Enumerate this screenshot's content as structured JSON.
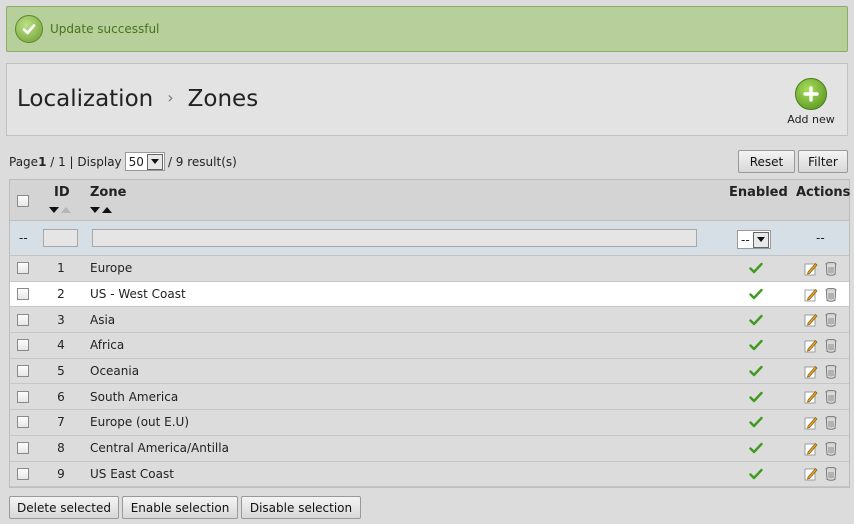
{
  "banner": {
    "message": "Update successful",
    "icon": "check-circle-icon"
  },
  "breadcrumb": {
    "parent": "Localization",
    "separator": "›",
    "current": "Zones"
  },
  "add_new": {
    "label": "Add new",
    "icon": "plus-circle-icon"
  },
  "pagination": {
    "page_prefix": "Page",
    "page_current": "1",
    "page_of": "/ 1 | Display",
    "display_value": "50",
    "results": "/ 9 result(s)"
  },
  "toolbar": {
    "reset_label": "Reset",
    "filter_label": "Filter"
  },
  "table": {
    "columns": {
      "id": "ID",
      "zone": "Zone",
      "enabled": "Enabled",
      "actions": "Actions"
    },
    "filter": {
      "checkbox_placeholder": "--",
      "enabled_value": "--",
      "actions_placeholder": "--"
    },
    "rows": [
      {
        "id": "1",
        "zone": "Europe",
        "enabled": true
      },
      {
        "id": "2",
        "zone": "US - West Coast",
        "enabled": true
      },
      {
        "id": "3",
        "zone": "Asia",
        "enabled": true
      },
      {
        "id": "4",
        "zone": "Africa",
        "enabled": true
      },
      {
        "id": "5",
        "zone": "Oceania",
        "enabled": true
      },
      {
        "id": "6",
        "zone": "South America",
        "enabled": true
      },
      {
        "id": "7",
        "zone": "Europe (out E.U)",
        "enabled": true
      },
      {
        "id": "8",
        "zone": "Central America/Antilla",
        "enabled": true
      },
      {
        "id": "9",
        "zone": "US East Coast",
        "enabled": true
      }
    ]
  },
  "bulk_actions": {
    "delete_label": "Delete selected",
    "enable_label": "Enable selection",
    "disable_label": "Disable selection"
  },
  "colors": {
    "accent_green": "#4f8e16",
    "banner_bg": "#b7cf9b",
    "banner_text": "#46731a"
  }
}
